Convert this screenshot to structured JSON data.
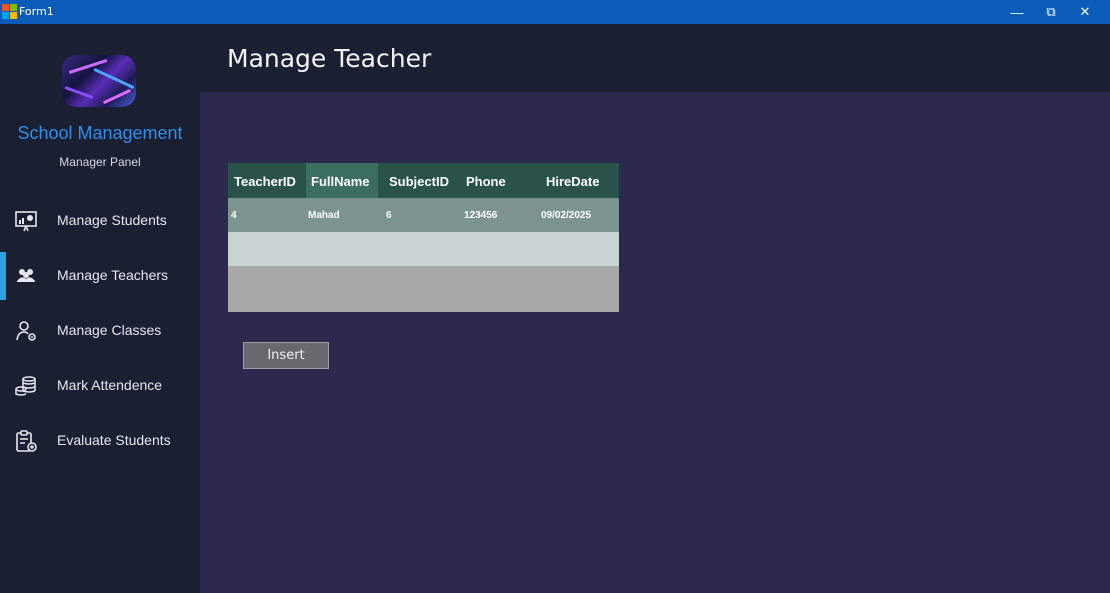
{
  "window": {
    "title": "Form1",
    "controls": {
      "minimize": "—",
      "restore": "⧉",
      "close": "✕"
    }
  },
  "sidebar": {
    "brand": "School Management",
    "subtitle": "Manager Panel",
    "items": [
      {
        "label": "Manage Students",
        "icon": "presentation-board-icon",
        "active": false
      },
      {
        "label": "Manage Teachers",
        "icon": "group-users-icon",
        "active": true
      },
      {
        "label": "Manage Classes",
        "icon": "user-settings-icon",
        "active": false
      },
      {
        "label": "Mark Attendence",
        "icon": "coin-stack-icon",
        "active": false
      },
      {
        "label": "Evaluate Students",
        "icon": "clipboard-add-icon",
        "active": false
      }
    ]
  },
  "header": {
    "title": "Manage Teacher"
  },
  "grid": {
    "columns": [
      "TeacherID",
      "FullName",
      "SubjectID",
      "Phone",
      "HireDate"
    ],
    "rows": [
      [
        "4",
        "Mahad",
        "6",
        "123456",
        "09/02/2025"
      ]
    ]
  },
  "actions": {
    "insert_label": "Insert"
  },
  "colors": {
    "accent": "#2ba2e0",
    "brand_text": "#2e8fe8",
    "titlebar": "#0a5cb8",
    "grid_header": "#28524a"
  }
}
